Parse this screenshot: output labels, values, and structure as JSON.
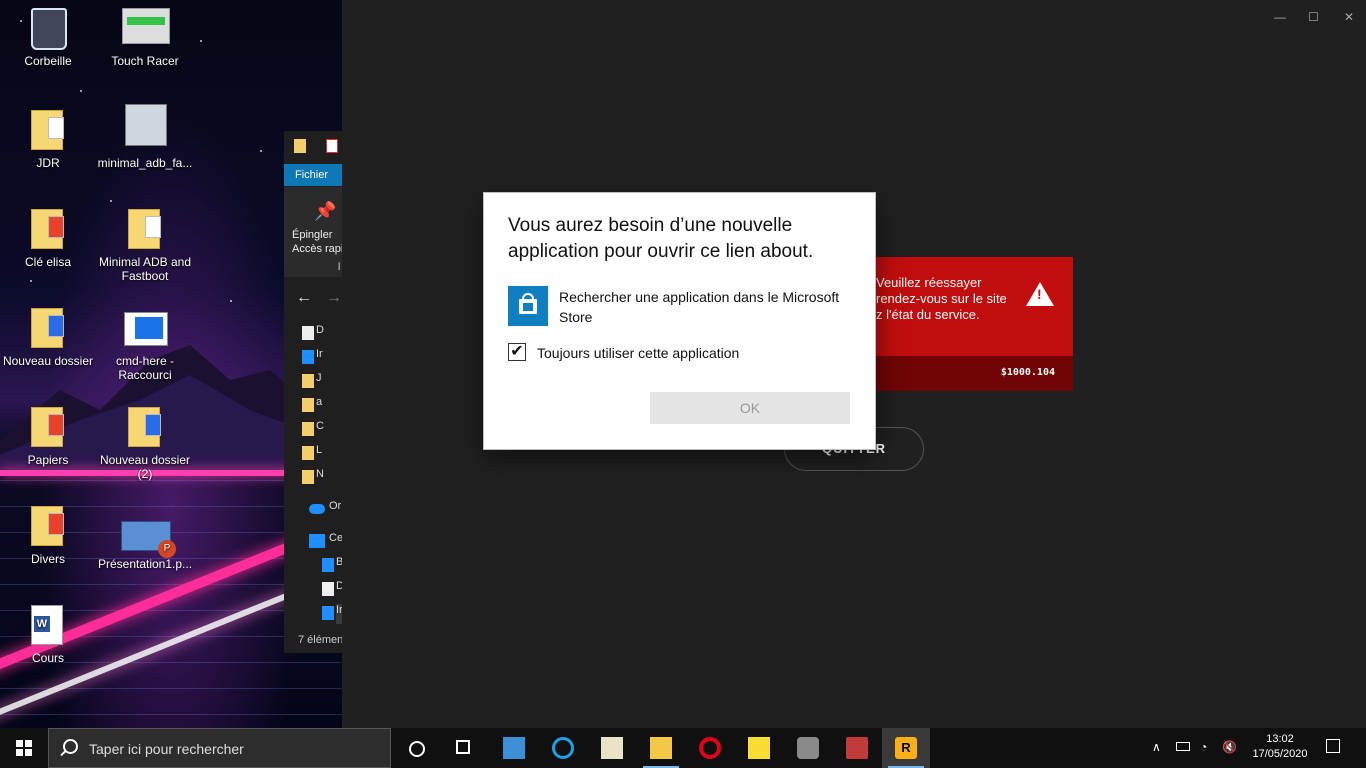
{
  "desktop": {
    "icons": [
      {
        "label": "Corbeille",
        "icon": "recycle-bin-icon"
      },
      {
        "label": "Touch Racer",
        "icon": "program-icon"
      },
      {
        "label": "JDR",
        "icon": "folder-icon"
      },
      {
        "label": "minimal_adb_fa...",
        "icon": "installer-icon"
      },
      {
        "label": "Clé elisa",
        "icon": "folder-icon"
      },
      {
        "label": "Minimal ADB and Fastboot",
        "icon": "folder-icon"
      },
      {
        "label": "Nouveau dossier",
        "icon": "folder-icon"
      },
      {
        "label": "cmd-here - Raccourci",
        "icon": "shortcut-icon"
      },
      {
        "label": "Papiers",
        "icon": "folder-icon"
      },
      {
        "label": "Nouveau dossier (2)",
        "icon": "folder-icon"
      },
      {
        "label": "Divers",
        "icon": "folder-icon"
      },
      {
        "label": "Présentation1.p...",
        "icon": "powerpoint-file-icon"
      },
      {
        "label": "Cours",
        "icon": "word-folder-icon"
      }
    ]
  },
  "explorer": {
    "tab": "Fichier",
    "pin_label_1": "Épingler",
    "pin_label_2": "Accès rapi",
    "extra": "l",
    "rows": [
      "D",
      "Ir",
      "J",
      "a",
      "C",
      "L",
      "N",
      "Or",
      "Ce",
      "B",
      "D",
      "Ir"
    ],
    "status": "7 élémen"
  },
  "app": {
    "window_controls": {
      "minimize": "—",
      "maximize": "☐",
      "close": "✕"
    },
    "error": {
      "line1": "Veuillez réessayer",
      "line2": "rendez-vous sur le site",
      "line3": "z l'état du service.",
      "code": "$1000.104"
    },
    "quit_label": "QUITTER"
  },
  "dialog": {
    "title": "Vous aurez besoin d’une nouvelle application pour ouvrir ce lien about.",
    "store_option": "Rechercher une application dans le Microsoft Store",
    "always_use_label": "Toujours utiliser cette application",
    "always_use_checked": true,
    "check_glyph": "✔",
    "ok_label": "OK"
  },
  "taskbar": {
    "search_placeholder": "Taper ici pour rechercher",
    "apps": [
      "cortana-icon",
      "task-view-icon",
      "wacom-icon",
      "logitech-icon",
      "notepad-icon",
      "file-explorer-icon",
      "opera-icon",
      "sticky-notes-icon",
      "app-icon",
      "game-icon",
      "rockstar-launcher-icon"
    ],
    "time": "13:02",
    "date": "17/05/2020",
    "colors": {
      "accent": "#76b9ed",
      "opera": "#e3001b",
      "rockstar": "#fcaf17"
    }
  }
}
